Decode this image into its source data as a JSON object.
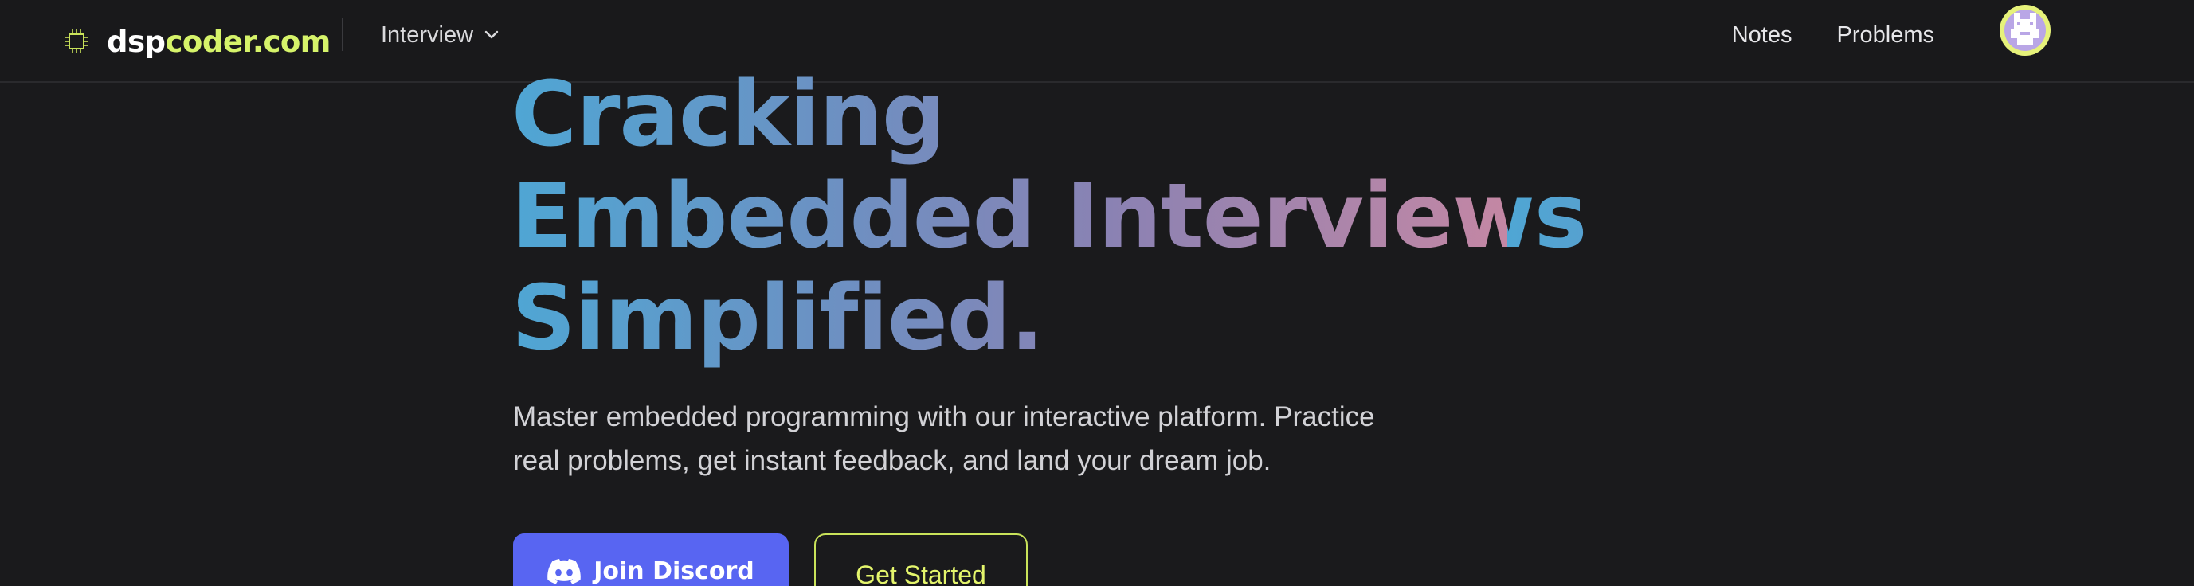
{
  "navbar": {
    "logo": {
      "part1": "dsp",
      "part2": "coder.com",
      "icon": "chip-icon"
    },
    "dropdown_label": "Interview",
    "links": [
      {
        "label": "Notes"
      },
      {
        "label": "Problems"
      }
    ],
    "avatar_icon": "pixel-avatar-icon"
  },
  "hero": {
    "title_lines": [
      "Cracking",
      "Embedded Interviews",
      "Simplified."
    ],
    "subtitle_line1": "Master embedded programming with our interactive platform. Practice",
    "subtitle_line2": "real problems, get instant feedback, and land your dream job."
  },
  "buttons": {
    "discord_label": "Join Discord",
    "discord_icon": "discord-icon",
    "start_label": "Get Started"
  },
  "colors": {
    "background": "#1a1a1c",
    "accent": "#d6f36a",
    "discord": "#5865f2",
    "gradient": [
      "#4fa6d4",
      "#8a82b3",
      "#c487a4"
    ]
  }
}
